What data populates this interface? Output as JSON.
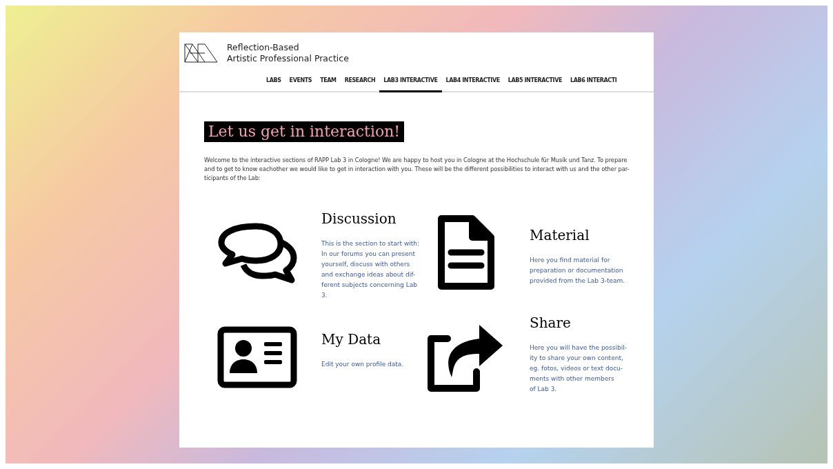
{
  "site": {
    "title_lines": [
      "Reflection-Based",
      "Artistic Professional Practice"
    ]
  },
  "nav": [
    {
      "label": "LABS",
      "selected": false
    },
    {
      "label": "EVENTS",
      "selected": false
    },
    {
      "label": "TEAM",
      "selected": false
    },
    {
      "label": "RESEARCH",
      "selected": false
    },
    {
      "label": "LAB3 INTERACTIVE",
      "selected": true
    },
    {
      "label": "LAB4 INTERACTIVE",
      "selected": false
    },
    {
      "label": "LAB5 INTERACTIVE",
      "selected": false
    },
    {
      "label": "LAB6 INTERACTI",
      "selected": false
    }
  ],
  "heading": "Let us get in interaction!",
  "intro_lines": [
    "Welcome to the interactive sections of RAPP Lab 3 in Cologne! We are happy to host you in Cologne at the Hochschule für Musik und Tanz. To prepare",
    "and to get to know eachother we would like to get in interaction with you. These will be the different possibilities to interact with us and the other par-",
    "ticipants of the Lab:"
  ],
  "sections": [
    {
      "kind": "chat",
      "title": "Discussion",
      "lines": [
        "This is the section to start with:",
        "In our forums you can present",
        "yourself, discuss with others",
        "and exchange ideas about dif-",
        "ferent subjects concerning Lab",
        "3."
      ]
    },
    {
      "kind": "document",
      "title": "Material",
      "lines": [
        "Here you find material for",
        "preparation or documentation",
        "provided from the Lab 3-team."
      ]
    },
    {
      "kind": "profile",
      "title": "My Data",
      "lines": [
        "Edit your own profile data."
      ]
    },
    {
      "kind": "share",
      "title": "Share",
      "lines": [
        "Here you will have the possibil-",
        "ity to share your own content,",
        "eg. fotos, videos or text docu-",
        "ments with other members",
        "of Lab 3."
      ]
    }
  ]
}
